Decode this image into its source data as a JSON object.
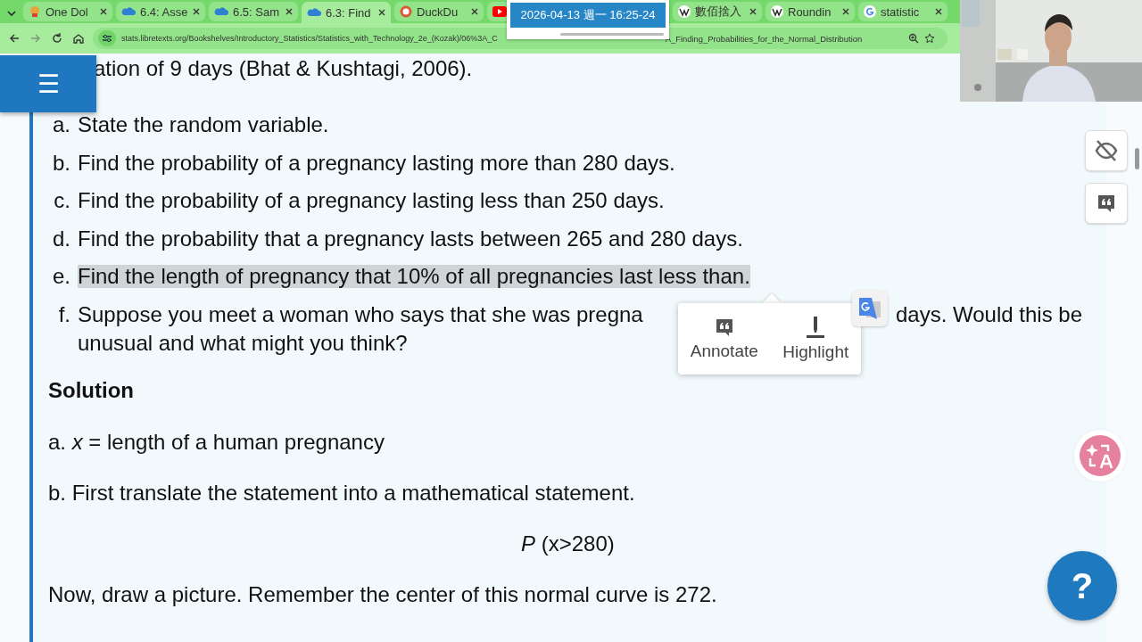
{
  "browser": {
    "tabs": [
      {
        "label": "One Dol",
        "selected": false
      },
      {
        "label": "6.4: Asse",
        "selected": false
      },
      {
        "label": "6.5: Sam",
        "selected": false
      },
      {
        "label": "6.3: Find",
        "selected": true
      },
      {
        "label": "DuckDu",
        "selected": false
      },
      {
        "selected": false
      },
      {
        "label": "數佰捨入",
        "selected": false
      },
      {
        "label": "Roundin",
        "selected": false
      },
      {
        "label": "statistic",
        "selected": false
      }
    ],
    "url_start": "stats.libretexts.org/Bookshelves/Introductory_Statistics/Statistics_with_Technology_2e_(Kozak)/06%3A_C",
    "url_end": "A_Finding_Probabilities_for_the_Normal_Distribution"
  },
  "clock_popup": {
    "text": "2026-04-13 週一 16:25-24"
  },
  "menu_button": {
    "label": "☰"
  },
  "content": {
    "intro_tail": "ation of 9 days (Bhat & Kushtagi, 2006).",
    "questions": [
      {
        "marker": "a.",
        "text": "State the random variable.",
        "highlighted": false
      },
      {
        "marker": "b.",
        "text": "Find the probability of a pregnancy lasting more than 280 days.",
        "highlighted": false
      },
      {
        "marker": "c.",
        "text": "Find the probability of a pregnancy lasting less than 250 days.",
        "highlighted": false
      },
      {
        "marker": "d.",
        "text": "Find the probability that a pregnancy lasts between 265 and 280 days.",
        "highlighted": false
      },
      {
        "marker": "e.",
        "text": "Find the length of pregnancy that 10% of all pregnancies last less than.",
        "highlighted": true
      },
      {
        "marker": "f.",
        "text": "Suppose you meet a woman who says that she was pregna",
        "text_after": "days. Would this be",
        "second_line": "unusual and what might you think?",
        "highlighted": false
      }
    ],
    "solution_heading": "Solution",
    "solution": [
      {
        "kind": "paragraph",
        "text": "a. *x* = length of a human pregnancy"
      },
      {
        "kind": "paragraph",
        "text": "b. First translate the statement into a mathematical statement."
      },
      {
        "kind": "formula",
        "text": "*P* (x>280)"
      },
      {
        "kind": "paragraph",
        "text": "Now, draw a picture. Remember the center of this normal curve is 272."
      }
    ]
  },
  "selection_popup": {
    "actions": [
      {
        "label": "Annotate"
      },
      {
        "label": "Highlight"
      }
    ]
  },
  "help_button": {
    "label": "?"
  }
}
